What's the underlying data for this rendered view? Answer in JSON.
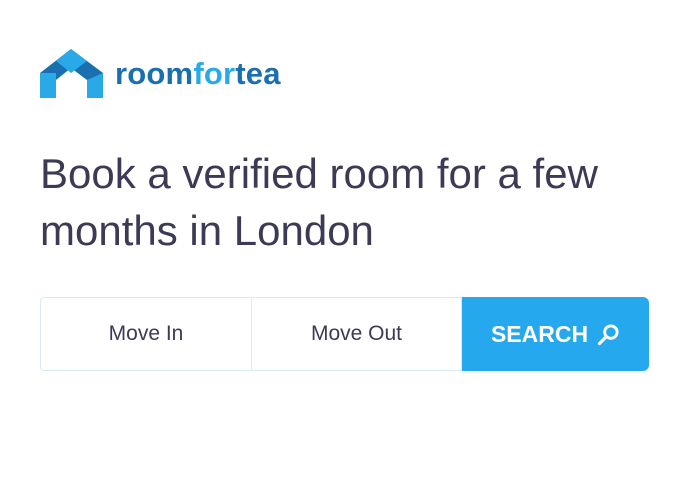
{
  "brand": {
    "logo_icon": "house-chevron-logo-icon",
    "name_part1": "room",
    "name_part2": "for",
    "name_part3": "tea",
    "colors": {
      "primary": "#1a6fb0",
      "accent": "#29a9e8"
    }
  },
  "hero": {
    "headline": "Book a verified room for a few months in London"
  },
  "search": {
    "move_in_label": "Move In",
    "move_out_label": "Move Out",
    "button_label": "SEARCH",
    "button_icon": "search-icon",
    "button_color": "#26a8ef",
    "text_color": "#3c3a55"
  }
}
